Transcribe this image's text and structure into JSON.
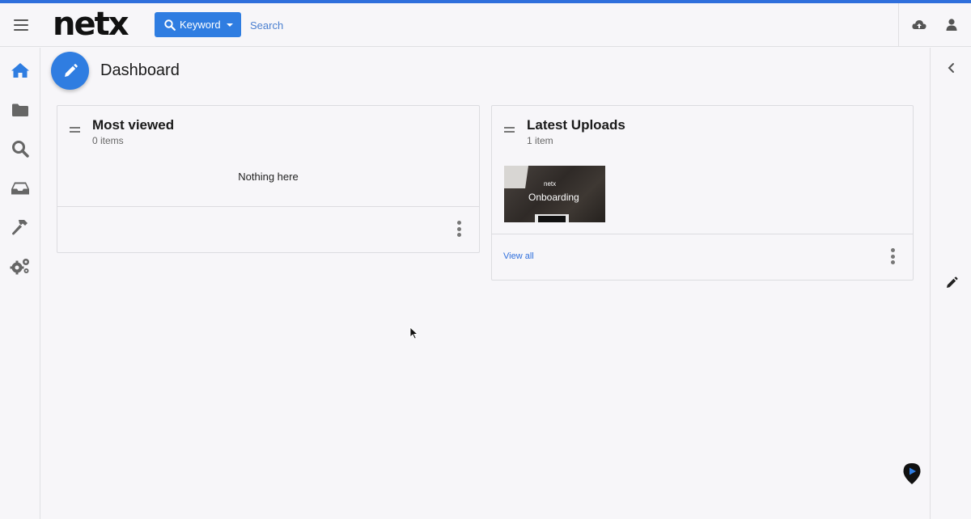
{
  "header": {
    "logo_text": "netx",
    "keyword_label": "Keyword",
    "search_placeholder": "Search"
  },
  "page": {
    "title": "Dashboard"
  },
  "sidebar": {
    "items": [
      {
        "name": "home",
        "icon": "home-icon",
        "active": true
      },
      {
        "name": "folders",
        "icon": "folder-icon",
        "active": false
      },
      {
        "name": "search",
        "icon": "search-icon",
        "active": false
      },
      {
        "name": "inbox",
        "icon": "inbox-icon",
        "active": false
      },
      {
        "name": "tools",
        "icon": "hammer-icon",
        "active": false
      },
      {
        "name": "settings",
        "icon": "gears-icon",
        "active": false
      }
    ]
  },
  "cards": {
    "most_viewed": {
      "title": "Most viewed",
      "count": "0 items",
      "empty_text": "Nothing here"
    },
    "latest_uploads": {
      "title": "Latest Uploads",
      "count": "1 item",
      "asset_label": "Onboarding",
      "asset_logo": "netx",
      "view_all": "View all"
    }
  },
  "colors": {
    "accent": "#2f7de1",
    "link": "#2f6fdc",
    "icon_gray": "#555555"
  }
}
